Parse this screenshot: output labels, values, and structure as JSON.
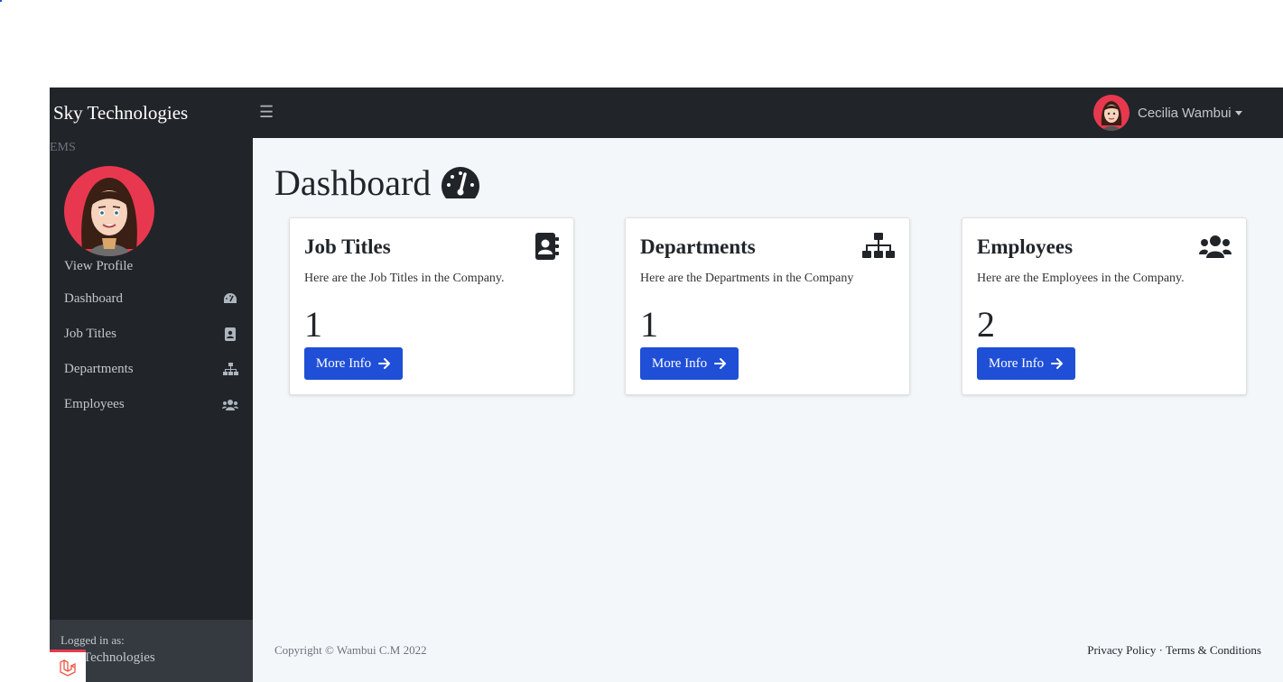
{
  "app": {
    "brand": "Sky Technologies",
    "section_label": "EMS",
    "toggle_icon": "menu-icon"
  },
  "user": {
    "name": "Cecilia Wambui",
    "view_profile": "View Profile",
    "logged_in_label": "Logged in as:",
    "logged_in_name": "Technologies"
  },
  "sidebar": {
    "items": [
      {
        "label": "Dashboard",
        "icon": "speedometer-icon"
      },
      {
        "label": "Job Titles",
        "icon": "address-book-icon"
      },
      {
        "label": "Departments",
        "icon": "sitemap-icon"
      },
      {
        "label": "Employees",
        "icon": "users-icon"
      }
    ]
  },
  "main": {
    "title": "Dashboard",
    "cards": [
      {
        "title": "Job Titles",
        "description": "Here are the Job Titles in the Company.",
        "count": "1",
        "button": "More Info"
      },
      {
        "title": "Departments",
        "description": "Here are the Departments in the Company",
        "count": "1",
        "button": "More Info"
      },
      {
        "title": "Employees",
        "description": "Here are the Employees in the Company.",
        "count": "2",
        "button": "More Info"
      }
    ]
  },
  "footer": {
    "copyright": "Copyright © Wambui C.M 2022",
    "privacy": "Privacy Policy",
    "separator": "·",
    "terms": "Terms & Conditions"
  },
  "colors": {
    "nav_bg": "#212529",
    "main_bg": "#f4f7fa",
    "button": "#1f4fd6",
    "avatar_bg": "#e8384f"
  }
}
